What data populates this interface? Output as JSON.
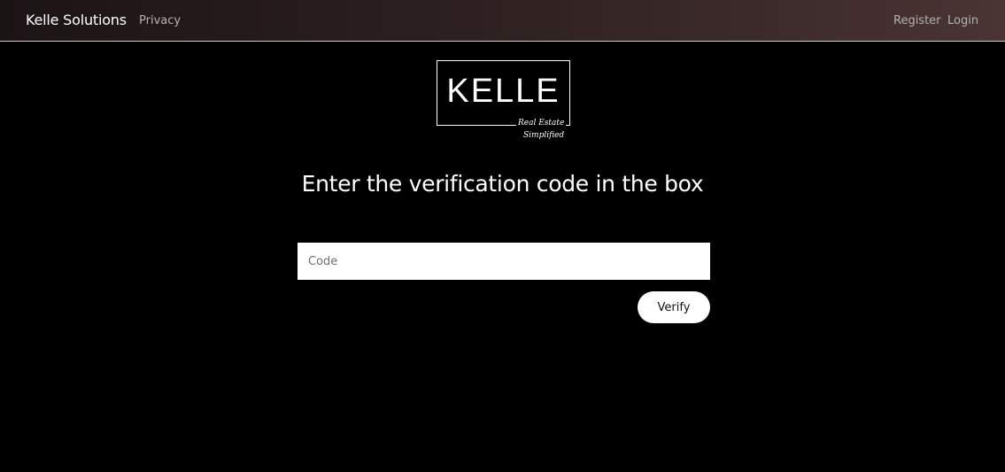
{
  "navbar": {
    "brand": "Kelle Solutions",
    "links": {
      "privacy": "Privacy",
      "register": "Register",
      "login": "Login"
    }
  },
  "logo": {
    "text": "KELLE",
    "tagline_1": "Real Estate",
    "tagline_2": "Simplified"
  },
  "main": {
    "heading": "Enter the verification code in the box",
    "code_input": {
      "value": "",
      "placeholder": "Code"
    },
    "verify_label": "Verify"
  }
}
